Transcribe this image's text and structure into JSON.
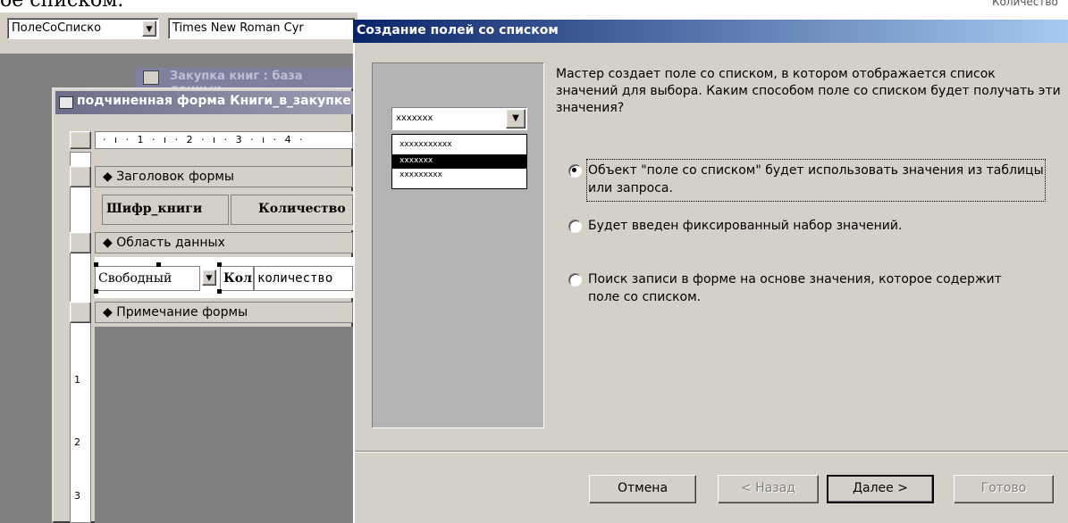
{
  "page_fragment": "ое списком.",
  "corner_fragment": "Количество",
  "toolbar": {
    "object_combo": "ПолеСоСписко",
    "font_combo": "Times New Roman Cyr"
  },
  "design": {
    "back_window_title": "Закупка книг : база данных",
    "subform_title": "подчиненная форма Книги_в_закупке",
    "ruler_text": "· ı · 1 · ı · 2 · ı · 3 · ı · 4 ·",
    "vruler_marks": [
      "1",
      "2",
      "3"
    ],
    "sections": {
      "header": "Заголовок формы",
      "detail": "Область данных",
      "footer": "Примечание формы"
    },
    "header_labels": [
      "Шифр_книги",
      "Количество"
    ],
    "detail_fields": {
      "combo": "Свободный",
      "num": "Кол",
      "qty": "количество"
    }
  },
  "wizard": {
    "title": "Создание полей со списком",
    "preview_combo_text": "xxxxxxx",
    "preview_list": [
      "xxxxxxxxxxx",
      "xxxxxxx",
      "xxxxxxxxx"
    ],
    "intro": "Мастер создает поле со списком, в котором отображается список значений для выбора.  Каким способом поле со списком будет получать эти значения?",
    "options": [
      {
        "label": "Объект \"поле со списком\" будет использовать значения из таблицы или запроса.",
        "selected": true
      },
      {
        "label": "Будет введен фиксированный набор значений.",
        "selected": false
      },
      {
        "label": "Поиск записи в форме на основе значения, которое содержит поле со списком.",
        "selected": false
      }
    ],
    "buttons": {
      "cancel": "Отмена",
      "back": "< Назад",
      "next": "Далее >",
      "finish": "Готово"
    }
  }
}
